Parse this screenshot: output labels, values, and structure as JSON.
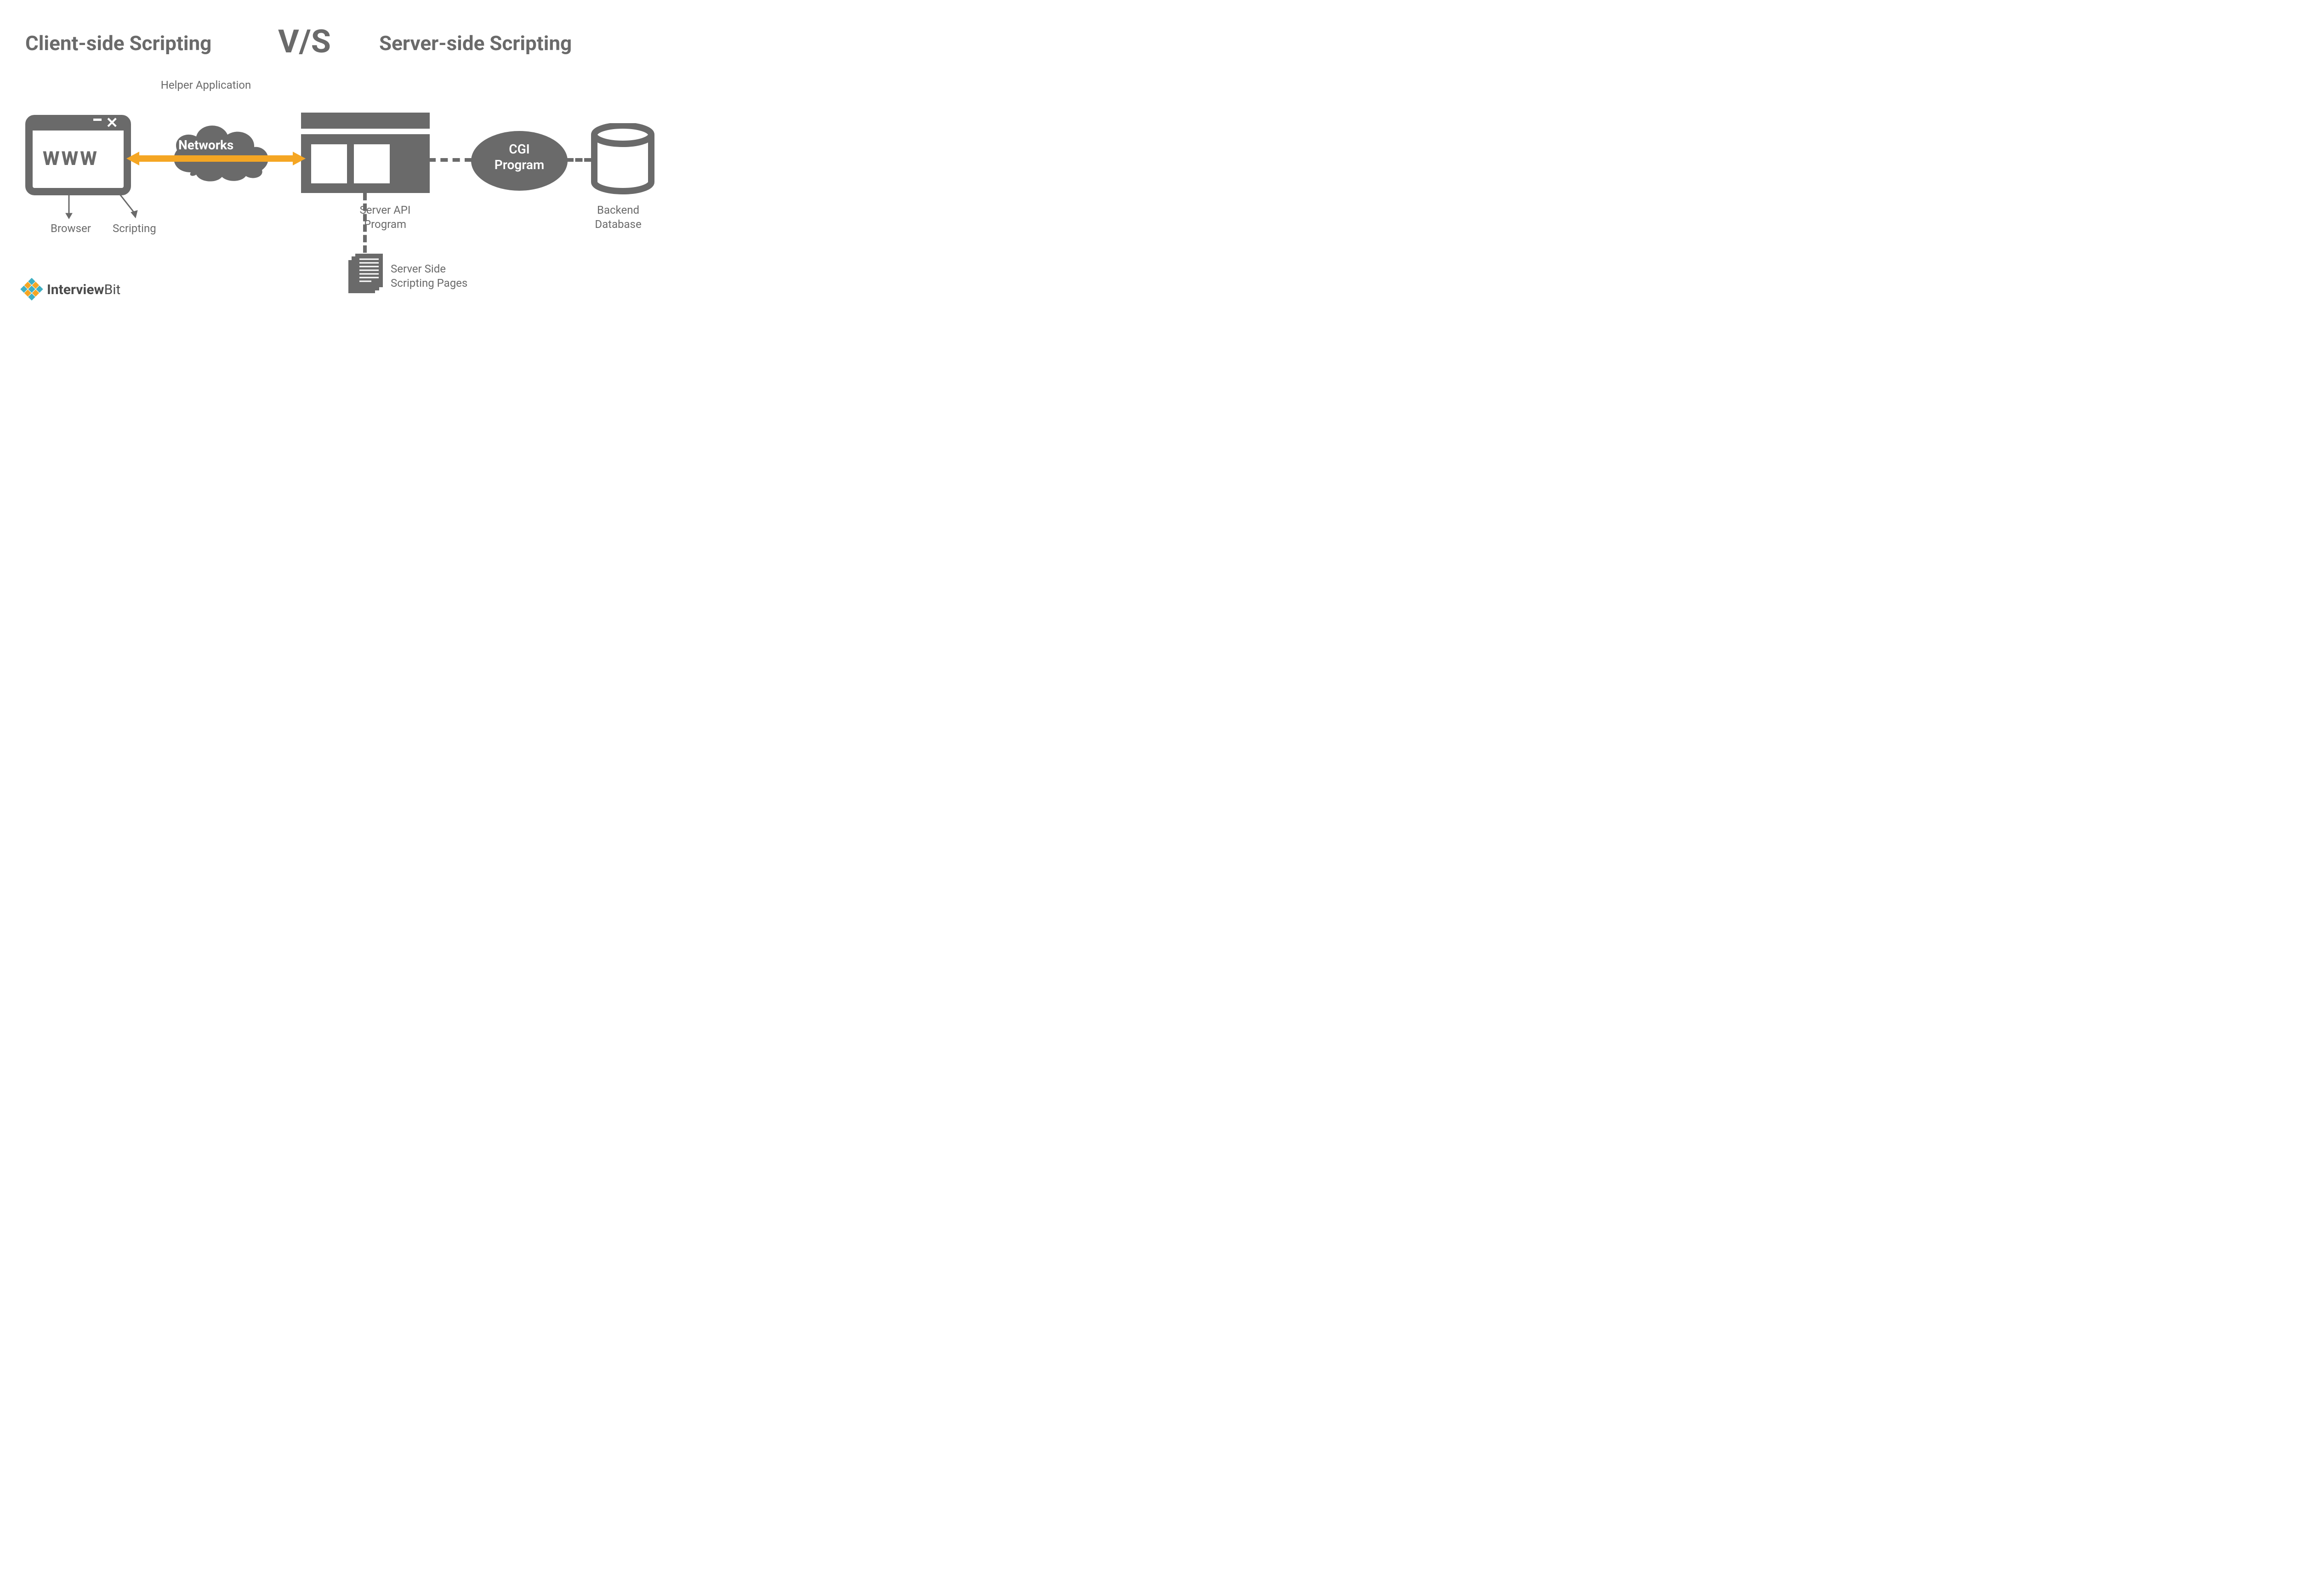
{
  "title": {
    "left": "Client-side Scripting",
    "vs": "V/S",
    "right": "Server-side Scripting"
  },
  "labels": {
    "helper": "Helper Application",
    "networks": "Networks",
    "browser": "Browser",
    "scripting": "Scripting",
    "serverapi": "Server API Program",
    "serverside": "Server Side Scripting Pages",
    "cgi": "CGI Program",
    "backend": "Backend Database",
    "www": "WWW"
  },
  "logo": {
    "name": "InterviewBit",
    "prefix": "Interview",
    "suffix": "Bit"
  }
}
